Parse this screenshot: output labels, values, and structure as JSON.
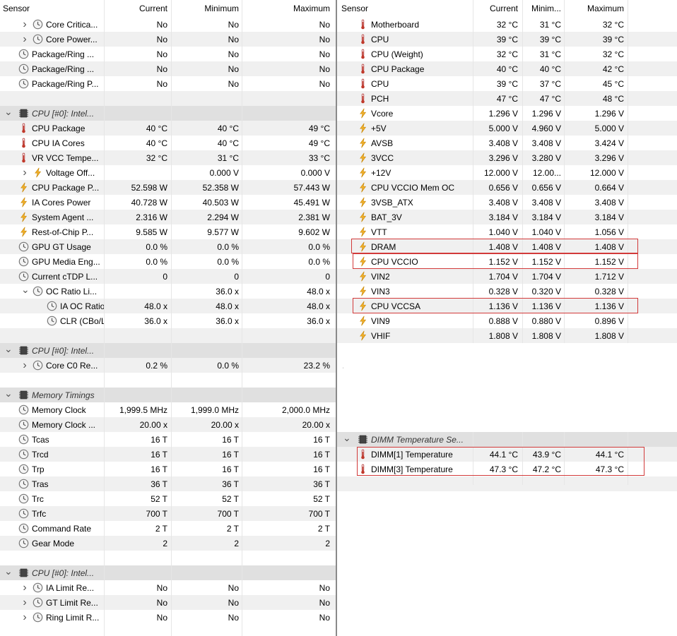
{
  "left": {
    "headers": {
      "sensor": "Sensor",
      "current": "Current",
      "minimum": "Minimum",
      "maximum": "Maximum"
    },
    "rows": [
      {
        "type": "item",
        "arrow": "right",
        "indent": 1,
        "icon": "clock-icon",
        "label": "Core Critica...",
        "cur": "No",
        "min": "No",
        "max": "No"
      },
      {
        "type": "item",
        "arrow": "right",
        "indent": 1,
        "icon": "clock-icon",
        "label": "Core Power...",
        "cur": "No",
        "min": "No",
        "max": "No"
      },
      {
        "type": "item",
        "indent": 0,
        "icon": "clock-icon",
        "label": "Package/Ring ...",
        "cur": "No",
        "min": "No",
        "max": "No"
      },
      {
        "type": "item",
        "indent": 0,
        "icon": "clock-icon",
        "label": "Package/Ring ...",
        "cur": "No",
        "min": "No",
        "max": "No"
      },
      {
        "type": "item",
        "indent": 0,
        "icon": "clock-icon",
        "label": "Package/Ring P...",
        "cur": "No",
        "min": "No",
        "max": "No"
      },
      {
        "type": "blank"
      },
      {
        "type": "group",
        "label": "CPU [#0]: Intel..."
      },
      {
        "type": "item",
        "indent": 0,
        "icon": "thermometer-icon",
        "label": "CPU Package",
        "cur": "40 °C",
        "min": "40 °C",
        "max": "49 °C"
      },
      {
        "type": "item",
        "indent": 0,
        "icon": "thermometer-icon",
        "label": "CPU IA Cores",
        "cur": "40 °C",
        "min": "40 °C",
        "max": "49 °C"
      },
      {
        "type": "item",
        "indent": 0,
        "icon": "thermometer-icon",
        "label": "VR VCC Tempe...",
        "cur": "32 °C",
        "min": "31 °C",
        "max": "33 °C"
      },
      {
        "type": "item",
        "arrow": "right",
        "indent": 1,
        "icon": "lightning-icon",
        "label": "Voltage Off...",
        "cur": "",
        "min": "0.000 V",
        "max": "0.000 V"
      },
      {
        "type": "item",
        "indent": 0,
        "icon": "lightning-icon",
        "label": "CPU Package P...",
        "cur": "52.598 W",
        "min": "52.358 W",
        "max": "57.443 W"
      },
      {
        "type": "item",
        "indent": 0,
        "icon": "lightning-icon",
        "label": "IA Cores Power",
        "cur": "40.728 W",
        "min": "40.503 W",
        "max": "45.491 W"
      },
      {
        "type": "item",
        "indent": 0,
        "icon": "lightning-icon",
        "label": "System Agent ...",
        "cur": "2.316 W",
        "min": "2.294 W",
        "max": "2.381 W"
      },
      {
        "type": "item",
        "indent": 0,
        "icon": "lightning-icon",
        "label": "Rest-of-Chip P...",
        "cur": "9.585 W",
        "min": "9.577 W",
        "max": "9.602 W"
      },
      {
        "type": "item",
        "indent": 0,
        "icon": "clock-icon",
        "label": "GPU GT Usage",
        "cur": "0.0 %",
        "min": "0.0 %",
        "max": "0.0 %"
      },
      {
        "type": "item",
        "indent": 0,
        "icon": "clock-icon",
        "label": "GPU Media Eng...",
        "cur": "0.0 %",
        "min": "0.0 %",
        "max": "0.0 %"
      },
      {
        "type": "item",
        "indent": 0,
        "icon": "clock-icon",
        "label": "Current cTDP L...",
        "cur": "0",
        "min": "0",
        "max": "0"
      },
      {
        "type": "item",
        "arrow": "down",
        "indent": 1,
        "icon": "clock-icon",
        "label": "OC Ratio Li...",
        "cur": "",
        "min": "36.0 x",
        "max": "48.0 x"
      },
      {
        "type": "item",
        "indent": 2,
        "icon": "clock-icon",
        "label": "IA OC Ratio...",
        "cur": "48.0 x",
        "min": "48.0 x",
        "max": "48.0 x"
      },
      {
        "type": "item",
        "indent": 2,
        "icon": "clock-icon",
        "label": "CLR (CBo/L...",
        "cur": "36.0 x",
        "min": "36.0 x",
        "max": "36.0 x"
      },
      {
        "type": "blank"
      },
      {
        "type": "group",
        "label": "CPU [#0]: Intel..."
      },
      {
        "type": "item",
        "arrow": "right",
        "indent": 1,
        "icon": "clock-icon",
        "label": "Core C0 Re...",
        "cur": "0.2 %",
        "min": "0.0 %",
        "max": "23.2 %"
      },
      {
        "type": "blank"
      },
      {
        "type": "group",
        "label": "Memory Timings"
      },
      {
        "type": "item",
        "indent": 0,
        "icon": "clock-icon",
        "label": "Memory Clock",
        "cur": "1,999.5 MHz",
        "min": "1,999.0 MHz",
        "max": "2,000.0 MHz"
      },
      {
        "type": "item",
        "indent": 0,
        "icon": "clock-icon",
        "label": "Memory Clock ...",
        "cur": "20.00 x",
        "min": "20.00 x",
        "max": "20.00 x"
      },
      {
        "type": "item",
        "indent": 0,
        "icon": "clock-icon",
        "label": "Tcas",
        "cur": "16 T",
        "min": "16 T",
        "max": "16 T"
      },
      {
        "type": "item",
        "indent": 0,
        "icon": "clock-icon",
        "label": "Trcd",
        "cur": "16 T",
        "min": "16 T",
        "max": "16 T"
      },
      {
        "type": "item",
        "indent": 0,
        "icon": "clock-icon",
        "label": "Trp",
        "cur": "16 T",
        "min": "16 T",
        "max": "16 T"
      },
      {
        "type": "item",
        "indent": 0,
        "icon": "clock-icon",
        "label": "Tras",
        "cur": "36 T",
        "min": "36 T",
        "max": "36 T"
      },
      {
        "type": "item",
        "indent": 0,
        "icon": "clock-icon",
        "label": "Trc",
        "cur": "52 T",
        "min": "52 T",
        "max": "52 T"
      },
      {
        "type": "item",
        "indent": 0,
        "icon": "clock-icon",
        "label": "Trfc",
        "cur": "700 T",
        "min": "700 T",
        "max": "700 T"
      },
      {
        "type": "item",
        "indent": 0,
        "icon": "clock-icon",
        "label": "Command Rate",
        "cur": "2 T",
        "min": "2 T",
        "max": "2 T"
      },
      {
        "type": "item",
        "indent": 0,
        "icon": "clock-icon",
        "label": "Gear Mode",
        "cur": "2",
        "min": "2",
        "max": "2"
      },
      {
        "type": "blank"
      },
      {
        "type": "group",
        "label": "CPU [#0]: Intel..."
      },
      {
        "type": "item",
        "arrow": "right",
        "indent": 1,
        "icon": "clock-icon",
        "label": "IA Limit Re...",
        "cur": "No",
        "min": "No",
        "max": "No"
      },
      {
        "type": "item",
        "arrow": "right",
        "indent": 1,
        "icon": "clock-icon",
        "label": "GT Limit Re...",
        "cur": "No",
        "min": "No",
        "max": "No"
      },
      {
        "type": "item",
        "arrow": "right",
        "indent": 1,
        "icon": "clock-icon",
        "label": "Ring Limit R...",
        "cur": "No",
        "min": "No",
        "max": "No"
      }
    ]
  },
  "right": {
    "headers": {
      "sensor": "Sensor",
      "current": "Current",
      "minimum": "Minim...",
      "maximum": "Maximum"
    },
    "rows": [
      {
        "type": "item",
        "indent": 0,
        "icon": "thermometer-icon",
        "label": "Motherboard",
        "cur": "32 °C",
        "min": "31 °C",
        "max": "32 °C"
      },
      {
        "type": "item",
        "indent": 0,
        "icon": "thermometer-icon",
        "label": "CPU",
        "cur": "39 °C",
        "min": "39 °C",
        "max": "39 °C"
      },
      {
        "type": "item",
        "indent": 0,
        "icon": "thermometer-icon",
        "label": "CPU (Weight)",
        "cur": "32 °C",
        "min": "31 °C",
        "max": "32 °C"
      },
      {
        "type": "item",
        "indent": 0,
        "icon": "thermometer-icon",
        "label": "CPU Package",
        "cur": "40 °C",
        "min": "40 °C",
        "max": "42 °C"
      },
      {
        "type": "item",
        "indent": 0,
        "icon": "thermometer-icon",
        "label": "CPU",
        "cur": "39 °C",
        "min": "37 °C",
        "max": "45 °C"
      },
      {
        "type": "item",
        "indent": 0,
        "icon": "thermometer-icon",
        "label": "PCH",
        "cur": "47 °C",
        "min": "47 °C",
        "max": "48 °C"
      },
      {
        "type": "item",
        "indent": 0,
        "icon": "lightning-icon",
        "label": "Vcore",
        "cur": "1.296 V",
        "min": "1.296 V",
        "max": "1.296 V"
      },
      {
        "type": "item",
        "indent": 0,
        "icon": "lightning-icon",
        "label": "+5V",
        "cur": "5.000 V",
        "min": "4.960 V",
        "max": "5.000 V"
      },
      {
        "type": "item",
        "indent": 0,
        "icon": "lightning-icon",
        "label": "AVSB",
        "cur": "3.408 V",
        "min": "3.408 V",
        "max": "3.424 V"
      },
      {
        "type": "item",
        "indent": 0,
        "icon": "lightning-icon",
        "label": "3VCC",
        "cur": "3.296 V",
        "min": "3.280 V",
        "max": "3.296 V"
      },
      {
        "type": "item",
        "indent": 0,
        "icon": "lightning-icon",
        "label": "+12V",
        "cur": "12.000 V",
        "min": "12.00...",
        "max": "12.000 V"
      },
      {
        "type": "item",
        "indent": 0,
        "icon": "lightning-icon",
        "label": "CPU VCCIO Mem OC",
        "cur": "0.656 V",
        "min": "0.656 V",
        "max": "0.664 V"
      },
      {
        "type": "item",
        "indent": 0,
        "icon": "lightning-icon",
        "label": "3VSB_ATX",
        "cur": "3.408 V",
        "min": "3.408 V",
        "max": "3.408 V"
      },
      {
        "type": "item",
        "indent": 0,
        "icon": "lightning-icon",
        "label": "BAT_3V",
        "cur": "3.184 V",
        "min": "3.184 V",
        "max": "3.184 V"
      },
      {
        "type": "item",
        "indent": 0,
        "icon": "lightning-icon",
        "label": "VTT",
        "cur": "1.040 V",
        "min": "1.040 V",
        "max": "1.056 V"
      },
      {
        "type": "item",
        "indent": 0,
        "icon": "lightning-icon",
        "label": "DRAM",
        "cur": "1.408 V",
        "min": "1.408 V",
        "max": "1.408 V"
      },
      {
        "type": "item",
        "indent": 0,
        "icon": "lightning-icon",
        "label": "CPU VCCIO",
        "cur": "1.152 V",
        "min": "1.152 V",
        "max": "1.152 V"
      },
      {
        "type": "item",
        "indent": 0,
        "icon": "lightning-icon",
        "label": "VIN2",
        "cur": "1.704 V",
        "min": "1.704 V",
        "max": "1.712 V"
      },
      {
        "type": "item",
        "indent": 0,
        "icon": "lightning-icon",
        "label": "VIN3",
        "cur": "0.328 V",
        "min": "0.320 V",
        "max": "0.328 V"
      },
      {
        "type": "item",
        "indent": 0,
        "icon": "lightning-icon",
        "label": "CPU VCCSA",
        "cur": "1.136 V",
        "min": "1.136 V",
        "max": "1.136 V"
      },
      {
        "type": "item",
        "indent": 0,
        "icon": "lightning-icon",
        "label": "VIN9",
        "cur": "0.888 V",
        "min": "0.880 V",
        "max": "0.896 V"
      },
      {
        "type": "item",
        "indent": 0,
        "icon": "lightning-icon",
        "label": "VHIF",
        "cur": "1.808 V",
        "min": "1.808 V",
        "max": "1.808 V"
      }
    ],
    "dimm": [
      {
        "type": "group",
        "label": "DIMM Temperature Se..."
      },
      {
        "type": "item",
        "indent": 0,
        "icon": "thermometer-icon",
        "label": "DIMM[1] Temperature",
        "cur": "44.1 °C",
        "min": "43.9 °C",
        "max": "44.1 °C"
      },
      {
        "type": "item",
        "indent": 0,
        "icon": "thermometer-icon",
        "label": "DIMM[3] Temperature",
        "cur": "47.3 °C",
        "min": "47.2 °C",
        "max": "47.3 °C"
      },
      {
        "type": "blank"
      }
    ]
  },
  "colors": {
    "highlight": "#d23a3a",
    "group_bg": "#e0e0e0",
    "alt_row": "#f0f0f0",
    "lightning": "#f3b12a",
    "thermometer": "#c0392b"
  }
}
